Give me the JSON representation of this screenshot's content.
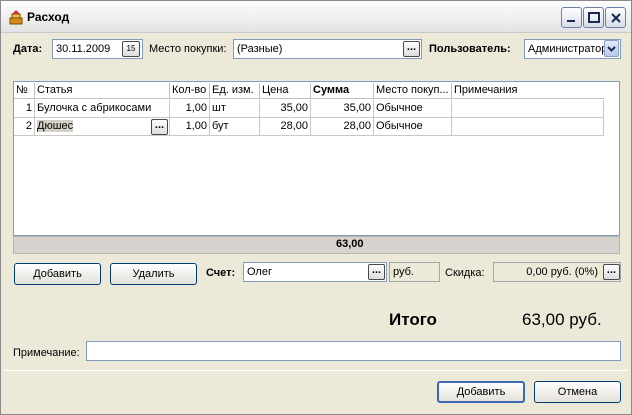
{
  "window": {
    "title": "Расход"
  },
  "header": {
    "date_label": "Дата:",
    "date_value": "30.11.2009",
    "calendar_day": "15",
    "place_label": "Место покупки:",
    "place_value": "(Разные)",
    "user_label": "Пользователь:",
    "user_value": "Администратор"
  },
  "table": {
    "columns": [
      "№",
      "Статья",
      "Кол-во",
      "Ед. изм.",
      "Цена",
      "Сумма",
      "Место покуп...",
      "Примечания"
    ],
    "rows": [
      {
        "num": "1",
        "item": "Булочка с абрикосами",
        "qty": "1,00",
        "unit": "шт",
        "price": "35,00",
        "sum": "35,00",
        "place": "Обычное",
        "note": ""
      },
      {
        "num": "2",
        "item": "Дюшес",
        "qty": "1,00",
        "unit": "бут",
        "price": "28,00",
        "sum": "28,00",
        "place": "Обычное",
        "note": ""
      }
    ],
    "total": "63,00"
  },
  "controls": {
    "add_row_label": "Добавить",
    "delete_row_label": "Удалить",
    "account_label": "Счет:",
    "account_value": "Олег",
    "currency": "руб.",
    "discount_label": "Скидка:",
    "discount_value": "0,00 руб. (0%)"
  },
  "summary": {
    "total_label": "Итого",
    "total_value": "63,00 руб."
  },
  "note": {
    "label": "Примечание:",
    "value": ""
  },
  "footer": {
    "ok_label": "Добавить",
    "cancel_label": "Отмена"
  }
}
